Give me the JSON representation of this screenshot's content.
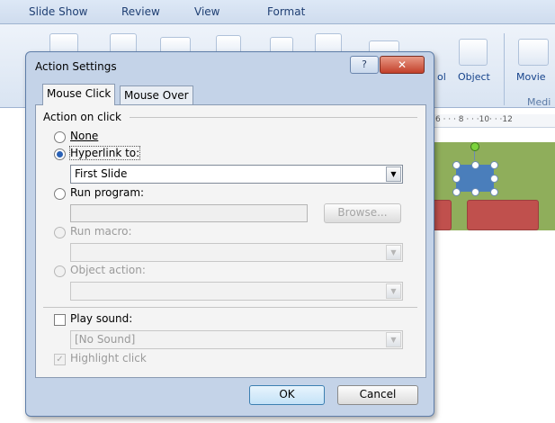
{
  "ribbon": {
    "tabs": [
      "Slide Show",
      "Review",
      "View",
      "Format"
    ],
    "object_label": "Object",
    "movie_label": "Movie",
    "group_label": "Medi",
    "partial_label": "ol"
  },
  "ruler": {
    "text": "6 · · · 8 · · ·10· · ·12"
  },
  "dialog": {
    "title": "Action Settings",
    "help_label": "?",
    "close_label": "✕",
    "tabs": {
      "mouse_click": "Mouse Click",
      "mouse_over": "Mouse Over"
    },
    "group_label": "Action on click",
    "options": {
      "none": "None",
      "hyperlink": "Hyperlink to:",
      "run_program": "Run program:",
      "run_macro": "Run macro:",
      "object_action": "Object action:"
    },
    "hyperlink_value": "First Slide",
    "browse_label": "Browse...",
    "play_sound": "Play sound:",
    "sound_value": "[No Sound]",
    "highlight_click": "Highlight click",
    "ok_label": "OK",
    "cancel_label": "Cancel"
  },
  "colors": {
    "accent": "#2a61b5",
    "close_red": "#c2402a",
    "slide_green": "#8fae5b",
    "shape_red": "#c0504d"
  }
}
